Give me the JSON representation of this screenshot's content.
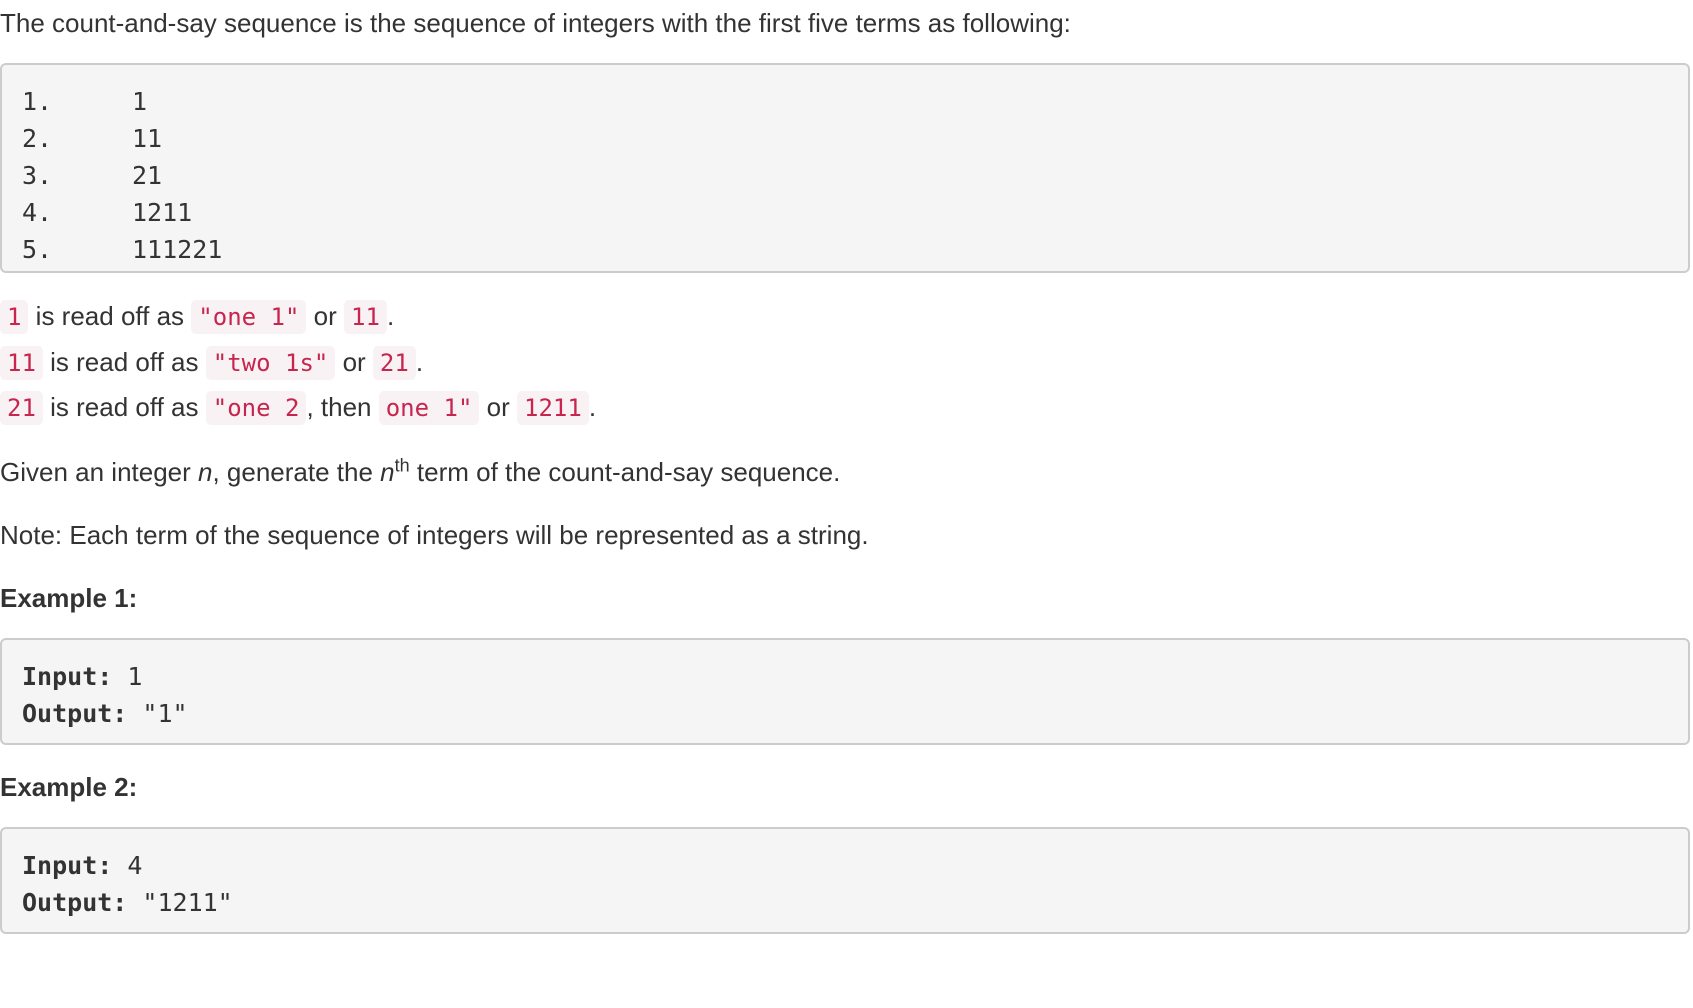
{
  "intro": "The count-and-say sequence is the sequence of integers with the first five terms as following:",
  "sequence": [
    {
      "num": "1.",
      "val": "1"
    },
    {
      "num": "2.",
      "val": "11"
    },
    {
      "num": "3.",
      "val": "21"
    },
    {
      "num": "4.",
      "val": "1211"
    },
    {
      "num": "5.",
      "val": "111221"
    }
  ],
  "reads": [
    {
      "a": "1",
      "mid1": " is read off as ",
      "b": "\"one 1\"",
      "mid2": " or ",
      "c": "11",
      "end": "."
    },
    {
      "a": "11",
      "mid1": " is read off as ",
      "b": "\"two 1s\"",
      "mid2": " or ",
      "c": "21",
      "end": "."
    },
    {
      "a": "21",
      "mid1": " is read off as ",
      "b": "\"one 2",
      "mid2": ", then ",
      "c": "one 1\"",
      "mid3": " or ",
      "d": "1211",
      "end": "."
    }
  ],
  "given": {
    "pre": "Given an integer ",
    "var": "n",
    "mid": ", generate the ",
    "var2": "n",
    "sup": "th",
    "post": " term of the count-and-say sequence."
  },
  "note": "Note: Each term of the sequence of integers will be represented as a string.",
  "examples": [
    {
      "title": "Example 1:",
      "input_label": "Input:",
      "input_value": " 1",
      "output_label": "Output:",
      "output_value": " \"1\""
    },
    {
      "title": "Example 2:",
      "input_label": "Input:",
      "input_value": " 4",
      "output_label": "Output:",
      "output_value": " \"1211\""
    }
  ]
}
